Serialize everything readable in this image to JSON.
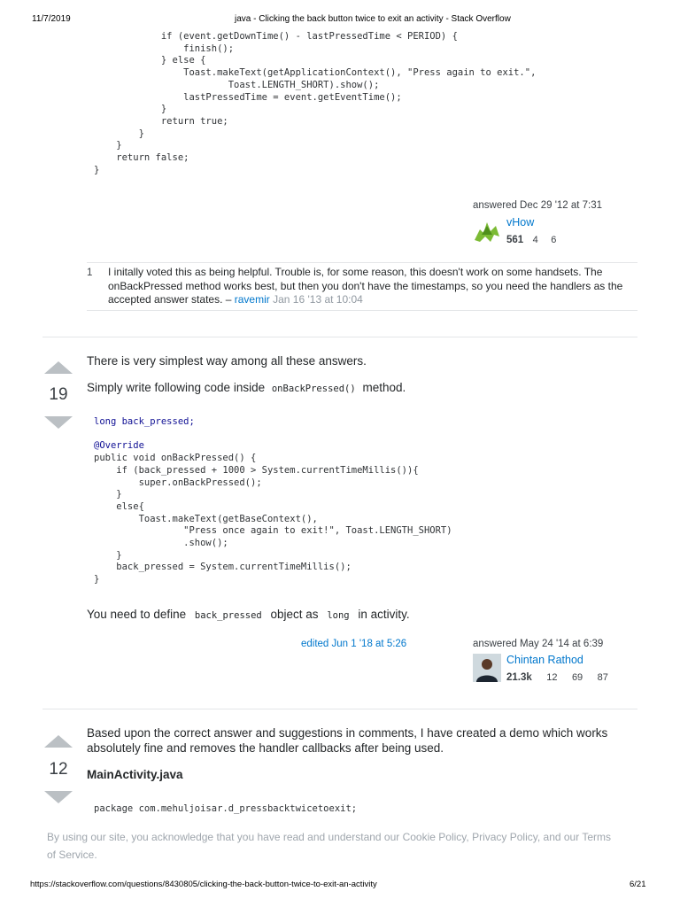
{
  "print_header": {
    "date": "11/7/2019",
    "title": "java - Clicking the back button twice to exit an activity - Stack Overflow"
  },
  "print_footer": {
    "url": "https://stackoverflow.com/questions/8430805/clicking-the-back-button-twice-to-exit-an-activity",
    "page": "6/21"
  },
  "answer1": {
    "code_lines": [
      "            if (event.getDownTime() - lastPressedTime < PERIOD) {",
      "                finish();",
      "            } else {",
      "                Toast.makeText(getApplicationContext(), \"Press again to exit.\",",
      "                        Toast.LENGTH_SHORT).show();",
      "                lastPressedTime = event.getEventTime();",
      "            }",
      "            return true;",
      "        }",
      "    }",
      "    return false;",
      "}"
    ],
    "answered": "answered Dec 29 '12 at 7:31",
    "user": {
      "name": "vHow",
      "rep": "561",
      "silver": "4",
      "bronze": "6"
    },
    "comment": {
      "score": "1",
      "text": "I initally voted this as being helpful. Trouble is, for some reason, this doesn't work on some handsets. The onBackPressed method works best, but then you don't have the timestamps, so you need the handlers as the accepted answer states. – ",
      "author": "ravemir",
      "date": "Jan 16 '13 at 10:04"
    }
  },
  "answer2": {
    "votes": "19",
    "p1": "There is very simplest way among all these answers.",
    "p2_before": "Simply write following code inside",
    "p2_code": "onBackPressed()",
    "p2_after": "method.",
    "code_lines": [
      "long back_pressed;",
      "",
      "@Override",
      "public void onBackPressed() {",
      "    if (back_pressed + 1000 > System.currentTimeMillis()){",
      "        super.onBackPressed();",
      "    }",
      "    else{",
      "        Toast.makeText(getBaseContext(),",
      "                \"Press once again to exit!\", Toast.LENGTH_SHORT)",
      "                .show();",
      "    }",
      "    back_pressed = System.currentTimeMillis();",
      "}"
    ],
    "p3_before": "You need to define",
    "p3_code1": "back_pressed",
    "p3_mid": "object as",
    "p3_code2": "long",
    "p3_after": "in activity.",
    "edited": "edited Jun 1 '18 at 5:26",
    "answered": "answered May 24 '14 at 6:39",
    "user": {
      "name": "Chintan Rathod",
      "rep": "21.3k",
      "gold": "12",
      "silver": "69",
      "bronze": "87"
    }
  },
  "answer3": {
    "votes": "12",
    "p1": "Based upon the correct answer and suggestions in comments, I have created a demo which works absolutely fine and removes the handler callbacks after being used.",
    "file_heading": "MainActivity.java",
    "code_line": "package com.mehuljoisar.d_pressbacktwicetoexit;"
  },
  "cookie_notice": "By using our site, you acknowledge that you have read and understand our Cookie Policy, Privacy Policy, and our Terms of Service.",
  "colors": {
    "link": "#0077cc",
    "vote_arrow": "#bbc0c4",
    "divider": "#e4e6e8"
  }
}
